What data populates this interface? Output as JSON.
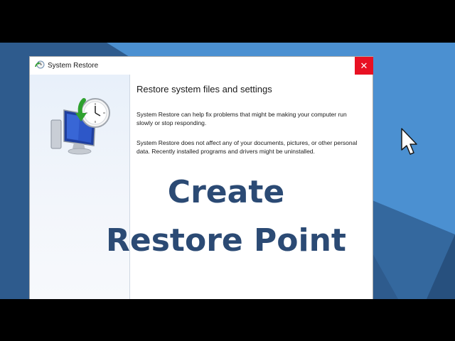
{
  "window": {
    "title": "System Restore",
    "close_glyph": "✕"
  },
  "content": {
    "heading": "Restore system files and settings",
    "paragraph1": "System Restore can help fix problems that might be making your computer run slowly or stop responding.",
    "paragraph2": "System Restore does not affect any of your documents, pictures, or other personal data. Recently installed programs and drivers might be uninstalled."
  },
  "overlay": {
    "line1": "Create",
    "line2": "Restore Point"
  },
  "colors": {
    "desktop_light": "#4a8fd0",
    "desktop_dark": "#2d5a8c",
    "close_button": "#e81123",
    "overlay_text": "#2b4a74"
  },
  "icons": [
    "system-restore-icon",
    "mouse-cursor-icon",
    "close-icon"
  ]
}
